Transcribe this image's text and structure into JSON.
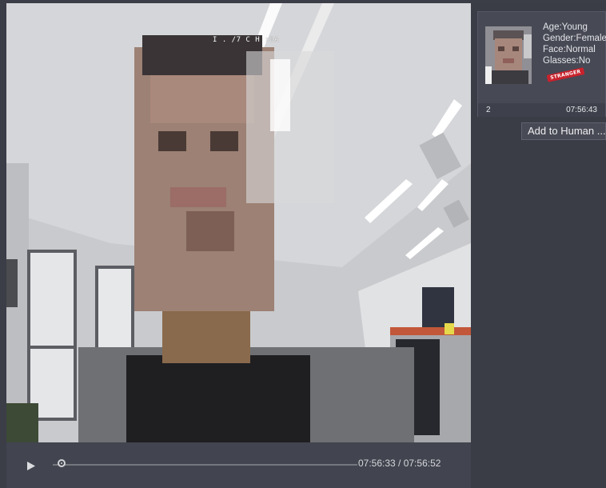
{
  "player": {
    "osd_timestamp": "I . /7 C H :0A",
    "time_display": "07:56:33 / 07:56:52",
    "current_time": "07:56:33",
    "total_time": "07:56:52",
    "progress_fraction": 0.03,
    "play_icon": "play-icon"
  },
  "face_card": {
    "attributes": {
      "age": "Age:Young",
      "gender": "Gender:Female",
      "face": "Face:Normal",
      "glasses": "Glasses:No"
    },
    "badge": "STRANGER",
    "index": "2",
    "time": "07:56:43"
  },
  "actions": {
    "add_to_human_label": "Add to Human ..."
  },
  "colors": {
    "badge": "#c8222c",
    "panel_bg": "#3b3d47"
  }
}
